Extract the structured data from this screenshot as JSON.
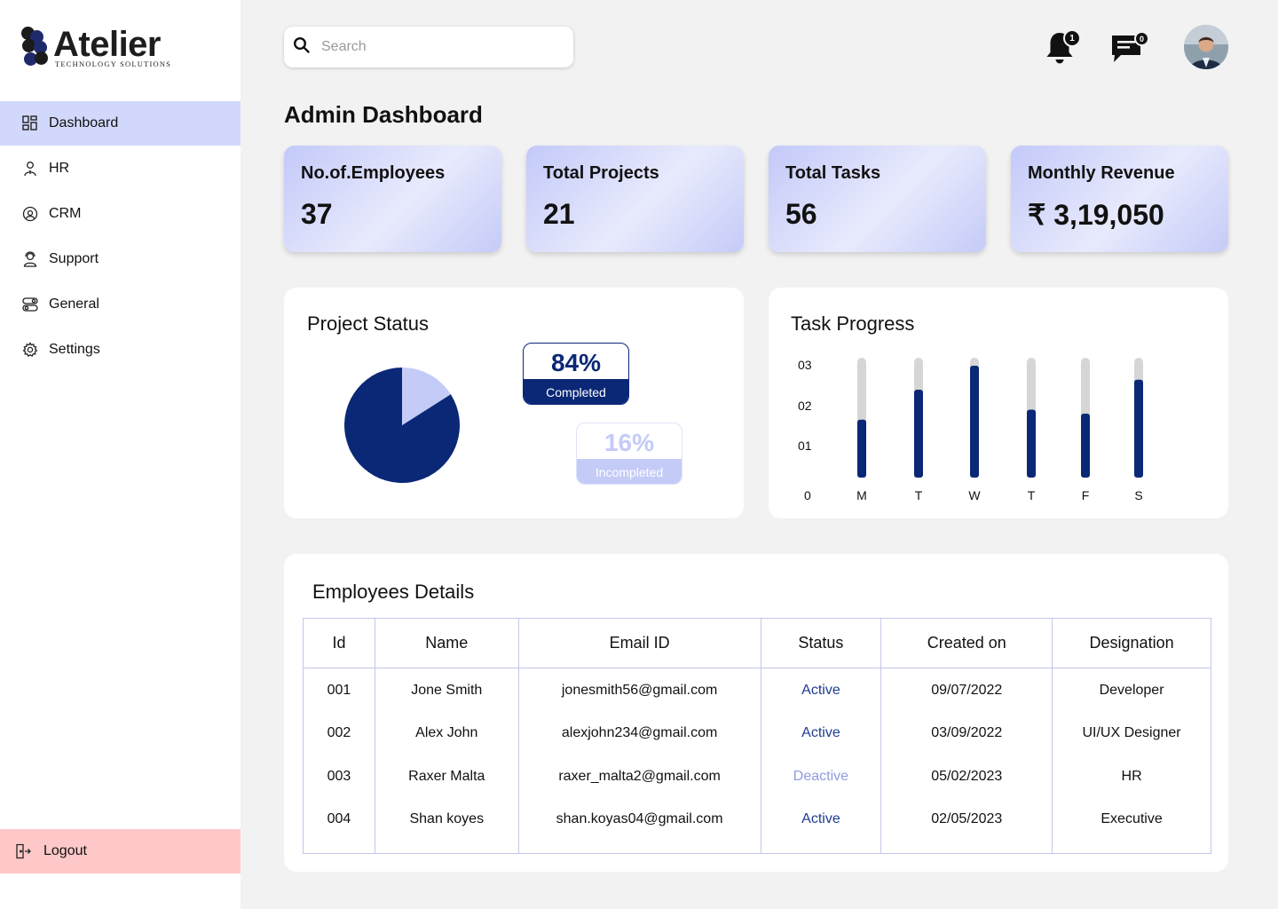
{
  "brand": {
    "name": "Atelier",
    "tagline": "TECHNOLOGY SOLUTIONS"
  },
  "sidebar": {
    "items": [
      {
        "label": "Dashboard",
        "icon": "dashboard-grid-icon",
        "active": true
      },
      {
        "label": "HR",
        "icon": "hr-person-icon"
      },
      {
        "label": "CRM",
        "icon": "crm-headset-icon"
      },
      {
        "label": "Support",
        "icon": "support-agent-icon"
      },
      {
        "label": "General",
        "icon": "general-toggle-icon"
      },
      {
        "label": "Settings",
        "icon": "gear-icon"
      }
    ],
    "logout_label": "Logout"
  },
  "header": {
    "search_placeholder": "Search",
    "notifications_count": "1",
    "messages_count": "0"
  },
  "page_title": "Admin Dashboard",
  "stats": [
    {
      "label": "No.of.Employees",
      "value": "37"
    },
    {
      "label": "Total Projects",
      "value": "21"
    },
    {
      "label": "Total Tasks",
      "value": "56"
    },
    {
      "label": "Monthly Revenue",
      "value": "₹ 3,19,050"
    }
  ],
  "project_status": {
    "title": "Project Status",
    "completed_pct": "84%",
    "completed_label": "Completed",
    "incompleted_pct": "16%",
    "incompleted_label": "Incompleted"
  },
  "task_progress": {
    "title": "Task Progress"
  },
  "chart_data": {
    "type": "bar",
    "categories": [
      "M",
      "T",
      "W",
      "T",
      "F",
      "S"
    ],
    "values": [
      1.45,
      2.2,
      2.8,
      1.7,
      1.6,
      2.45
    ],
    "ylim": [
      0,
      3
    ],
    "y_ticks": [
      "0",
      "01",
      "02",
      "03"
    ],
    "colors": {
      "fill": "#0b2877",
      "track": "#d6d6d6"
    }
  },
  "pie_data": {
    "values": [
      84,
      16
    ],
    "colors": [
      "#0b2877",
      "#c4cbf7"
    ]
  },
  "employees": {
    "title": "Employees Details",
    "columns": [
      "Id",
      "Name",
      "Email ID",
      "Status",
      "Created on",
      "Designation"
    ],
    "rows": [
      [
        "001",
        "Jone Smith",
        "jonesmith56@gmail.com",
        "Active",
        "09/07/2022",
        "Developer"
      ],
      [
        "002",
        "Alex John",
        "alexjohn234@gmail.com",
        "Active",
        "03/09/2022",
        "UI/UX Designer"
      ],
      [
        "003",
        "Raxer Malta",
        "raxer_malta2@gmail.com",
        "Deactive",
        "05/02/2023",
        "HR"
      ],
      [
        "004",
        "Shan koyes",
        "shan.koyas04@gmail.com",
        "Active",
        "02/05/2023",
        "Executive"
      ]
    ]
  }
}
